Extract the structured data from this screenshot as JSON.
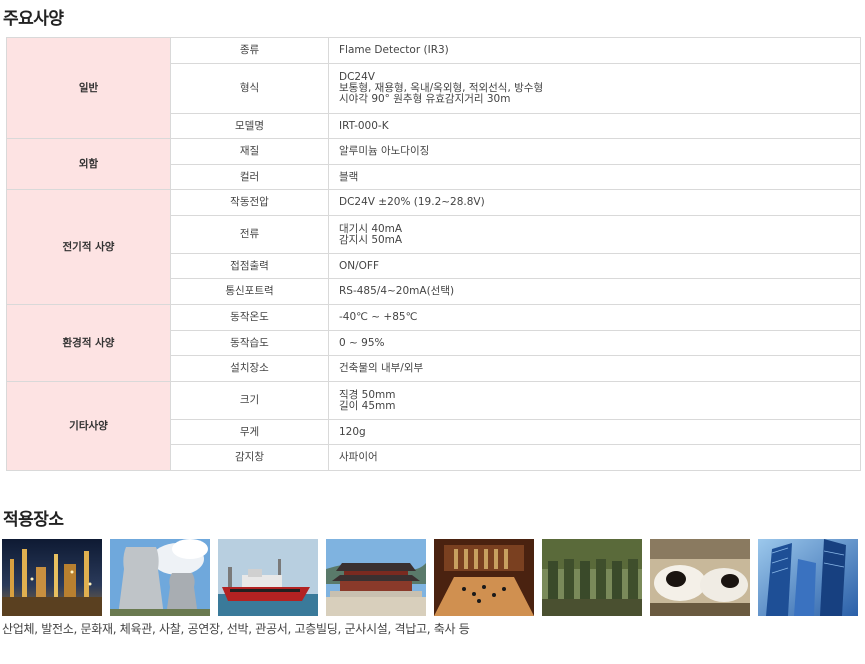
{
  "spec_title": "주요사양",
  "application_title": "적용장소",
  "spec_rows": [
    {
      "category": "일반",
      "item": "종류",
      "value": [
        "Flame Detector (IR3)"
      ]
    },
    {
      "category": "",
      "item": "형식",
      "value": [
        "DC24V",
        "보통형, 재용형, 옥내/옥외형, 적외선식, 방수형",
        "시야각 90° 원추형 유효감지거리 30m"
      ]
    },
    {
      "category": "",
      "item": "모델명",
      "value": [
        "IRT-000-K"
      ]
    },
    {
      "category": "외함",
      "item": "재질",
      "value": [
        "알루미늄 아노다이징"
      ]
    },
    {
      "category": "",
      "item": "컬러",
      "value": [
        "블랙"
      ]
    },
    {
      "category": "전기적 사양",
      "item": "작동전압",
      "value": [
        "DC24V ±20% (19.2~28.8V)"
      ]
    },
    {
      "category": "",
      "item": "전류",
      "value": [
        "대기시 40mA",
        "감지시 50mA"
      ]
    },
    {
      "category": "",
      "item": "접점출력",
      "value": [
        "ON/OFF"
      ]
    },
    {
      "category": "",
      "item": "통신포트력",
      "value": [
        "RS-485/4~20mA(선택)"
      ]
    },
    {
      "category": "환경적 사양",
      "item": "동작온도",
      "value": [
        "-40℃ ~ +85℃"
      ]
    },
    {
      "category": "",
      "item": "동작습도",
      "value": [
        "0 ~ 95%"
      ]
    },
    {
      "category": "",
      "item": "설치장소",
      "value": [
        "건축물의 내부/외부"
      ]
    },
    {
      "category": "기타사양",
      "item": "크기",
      "value": [
        "직경 50mm",
        "길이 45mm"
      ]
    },
    {
      "category": "",
      "item": "무게",
      "value": [
        "120g"
      ]
    },
    {
      "category": "",
      "item": "감지창",
      "value": [
        "사파이어"
      ]
    }
  ],
  "photos": [
    {
      "name": "industrial-plant-photo",
      "colors": [
        "#1a2a4a",
        "#c08a3a"
      ]
    },
    {
      "name": "power-plant-photo",
      "colors": [
        "#6fa8dc",
        "#d9d9d9"
      ]
    },
    {
      "name": "ship-photo",
      "colors": [
        "#9ab6cc",
        "#b22222"
      ]
    },
    {
      "name": "palace-photo",
      "colors": [
        "#7fb3e0",
        "#5a4a3a"
      ]
    },
    {
      "name": "concert-hall-photo",
      "colors": [
        "#5a2a10",
        "#d09050"
      ]
    },
    {
      "name": "soldiers-photo",
      "colors": [
        "#5a6a3a",
        "#3a4a2a"
      ]
    },
    {
      "name": "cows-photo",
      "colors": [
        "#f0e8d8",
        "#2a1a10"
      ]
    },
    {
      "name": "skyscrapers-photo",
      "colors": [
        "#2a5fa8",
        "#9cc8ec"
      ]
    }
  ],
  "application_caption": "산업체, 발전소, 문화재, 체육관, 사찰, 공연장, 선박, 관공서, 고층빌딩, 군사시설, 격납고, 축사 등"
}
